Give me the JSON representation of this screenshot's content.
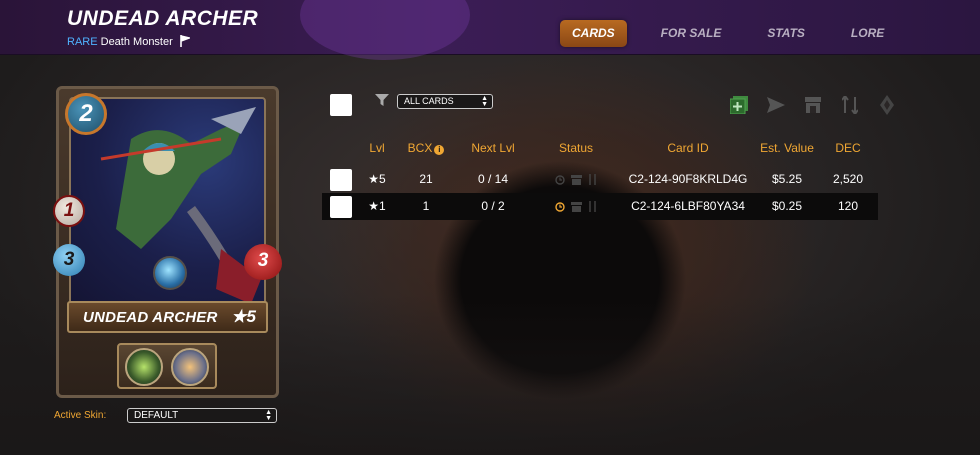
{
  "header": {
    "title": "UNDEAD ARCHER",
    "rarity": "RARE",
    "type": "Death Monster",
    "nav": [
      {
        "label": "CARDS",
        "active": true
      },
      {
        "label": "FOR SALE",
        "active": false
      },
      {
        "label": "STATS",
        "active": false
      },
      {
        "label": "LORE",
        "active": false
      }
    ]
  },
  "card": {
    "mana": "2",
    "ranged": "1",
    "speed": "3",
    "health": "3",
    "name": "UNDEAD ARCHER",
    "level": "★5",
    "element_color": "#6fc9f2"
  },
  "skin": {
    "label": "Active Skin:",
    "value": "DEFAULT"
  },
  "toolbar": {
    "filter_value": "ALL CARDS",
    "actions": [
      "add-icon",
      "send-icon",
      "market-icon",
      "transfer-icon",
      "burn-icon"
    ]
  },
  "table": {
    "headers": {
      "lvl": "Lvl",
      "bcx": "BCX",
      "next": "Next Lvl",
      "status": "Status",
      "id": "Card ID",
      "value": "Est. Value",
      "dec": "DEC"
    },
    "rows": [
      {
        "lvl": "★5",
        "bcx": "21",
        "next": "0 / 14",
        "id": "C2-124-90F8KRLD4G",
        "value": "$5.25",
        "dec": "2,520",
        "selected": false
      },
      {
        "lvl": "★1",
        "bcx": "1",
        "next": "0 / 2",
        "id": "C2-124-6LBF80YA34",
        "value": "$0.25",
        "dec": "120",
        "selected": true
      }
    ]
  },
  "colors": {
    "accent": "#f0a733",
    "header_bg": "#3b1d55",
    "rarity": "#4fb3ff",
    "nav_active": "#b86a21"
  }
}
